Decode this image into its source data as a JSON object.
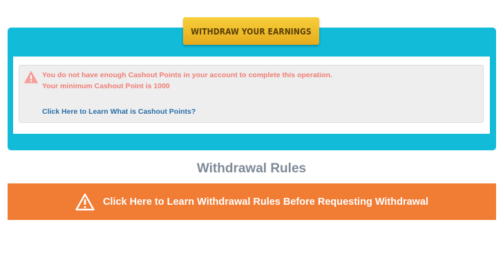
{
  "header": {
    "title": "WITHDRAW YOUR EARNINGS"
  },
  "alert": {
    "icon": "warning-triangle-icon",
    "message_line1": "You do not have enough Cashout Points in your account to complete this operation.",
    "message_line2": "Your minimum Cashout Point is 1000",
    "learn_link": "Click Here to Learn What is Cashout Points?"
  },
  "rules": {
    "heading": "Withdrawal Rules",
    "banner_icon": "warning-triangle-icon",
    "banner_text": "Click Here to Learn Withdrawal Rules Before Requesting Withdrawal"
  },
  "colors": {
    "panel": "#12bbd8",
    "title_tab": "#f2c12e",
    "alert_text": "#f07e75",
    "link": "#2a6ea8",
    "banner": "#f17c34",
    "heading": "#7f8a97"
  }
}
